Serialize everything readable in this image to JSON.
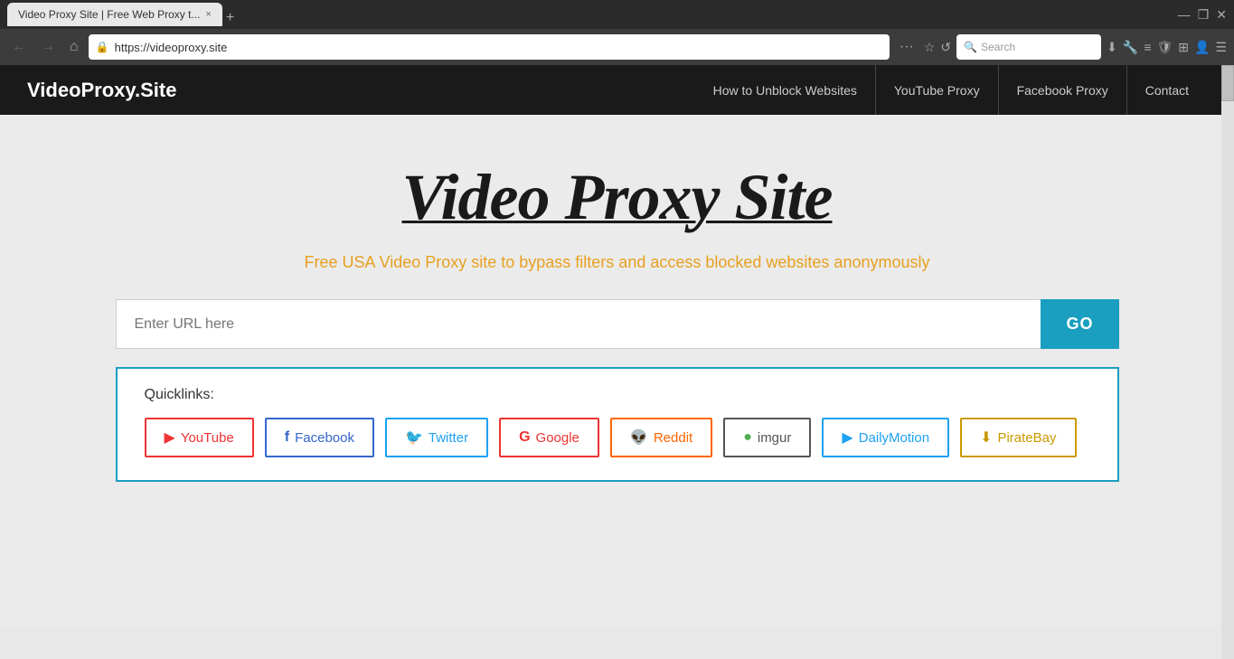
{
  "browser": {
    "tab_title": "Video Proxy Site | Free Web Proxy t...",
    "tab_close": "×",
    "tab_new": "+",
    "nav_back": "←",
    "nav_forward": "→",
    "nav_home": "⌂",
    "url": "https://videoproxy.site",
    "url_protocol": "https://",
    "url_domain": "videoproxy.site",
    "more_btn": "···",
    "reload_btn": "↺",
    "search_placeholder": "Search",
    "download_icon": "⬇",
    "tools_icon": "🔧",
    "bookmarks_icon": "📚",
    "extensions_icon": "🧩",
    "windows_icon": "⊞",
    "profile_icon": "👤",
    "pin_icon": "📌"
  },
  "site": {
    "logo": "VideoProxy.Site",
    "nav_links": [
      {
        "label": "How to Unblock Websites"
      },
      {
        "label": "YouTube Proxy"
      },
      {
        "label": "Facebook Proxy"
      },
      {
        "label": "Contact"
      }
    ]
  },
  "hero": {
    "title": "Video Proxy Site",
    "subtitle": "Free USA Video Proxy site to bypass filters and access blocked websites anonymously"
  },
  "search": {
    "placeholder": "Enter URL here",
    "go_label": "GO"
  },
  "quicklinks": {
    "label": "Quicklinks:",
    "buttons": [
      {
        "name": "YouTube",
        "class": "youtube",
        "icon": "▶"
      },
      {
        "name": "Facebook",
        "class": "facebook",
        "icon": "f"
      },
      {
        "name": "Twitter",
        "class": "twitter",
        "icon": "🐦"
      },
      {
        "name": "Google",
        "class": "google",
        "icon": "G"
      },
      {
        "name": "Reddit",
        "class": "reddit",
        "icon": "👽"
      },
      {
        "name": "imgur",
        "class": "imgur",
        "icon": "●"
      },
      {
        "name": "DailyMotion",
        "class": "dailymotion",
        "icon": "▶"
      },
      {
        "name": "PirateBay",
        "class": "piratebay",
        "icon": "⬇"
      }
    ]
  }
}
